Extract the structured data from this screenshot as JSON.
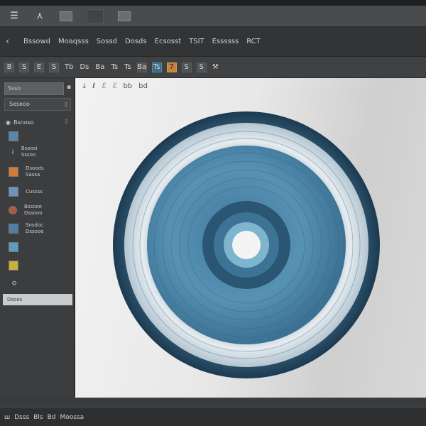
{
  "titlebar": {
    "icons": [
      "list-icon",
      "person-icon",
      "document-icon",
      "monitor-icon",
      "window-icon"
    ]
  },
  "menubar": {
    "back_glyph": "‹",
    "items": [
      "Bssowd",
      "Moaqsss",
      "Sossd",
      "Dosds",
      "Ecsosst",
      "TSIT",
      "Essssss",
      "RCT"
    ]
  },
  "toolbar": {
    "tools": [
      "B",
      "S",
      "E",
      "S",
      "Tb",
      "Ds",
      "Ba",
      "Ts",
      "Ts",
      "Ba",
      "Ts",
      "7",
      "S",
      "S"
    ]
  },
  "sidebar": {
    "search_placeholder": "Ssso",
    "field_label": "Seseoo",
    "section_label": "Bsnoso",
    "items": [
      {
        "label": "",
        "thumb_color": "#5b86a8"
      },
      {
        "label": "Bsoosi\nSssoo",
        "thumb_color": "#5a5b5e"
      },
      {
        "label": "Dsoods\nSassa",
        "thumb_color": "#d07a3c"
      },
      {
        "label": "Cussss",
        "thumb_color": "#6b95b8"
      },
      {
        "label": "Bssooe\nDssooo",
        "thumb_color": "#b05a3c"
      },
      {
        "label": "Sosdoc\nDssooe",
        "thumb_color": "#4f7ea8"
      },
      {
        "label": "",
        "thumb_color": "#5c9ec2"
      },
      {
        "label": "",
        "thumb_color": "#c9b03a"
      },
      {
        "label": "",
        "thumb_color": "#666"
      }
    ],
    "selected_label": "Dsoos"
  },
  "canvas": {
    "tools": [
      "ↆ",
      "ℓ",
      "ℰ",
      "ℰ",
      "bb",
      "bd"
    ]
  },
  "statusbar": {
    "items": [
      "ш",
      "Dsss",
      "Bls",
      "Bd",
      "Moossa"
    ]
  },
  "colors": {
    "disc_outer": "#24465e",
    "disc_ring_light": "#d9e1e6",
    "disc_inner": "#4d8aad",
    "accent_tool": "#c2823f"
  }
}
